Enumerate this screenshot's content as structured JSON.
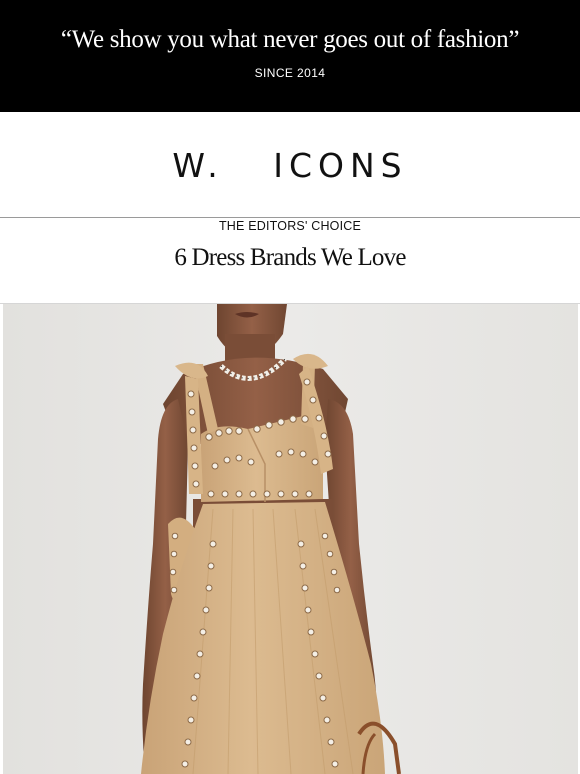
{
  "banner": {
    "quote": "“We show you what never goes out of fashion”",
    "since": "SINCE 2014"
  },
  "brand": {
    "logo": "W.   ICONS"
  },
  "article": {
    "kicker": "THE EDITORS' CHOICE",
    "headline": "6 Dress Brands We Love"
  },
  "hero_image": {
    "subject": "model-in-tan-eyelet-cutout-dress-icon",
    "colors": {
      "background": "#e7e6e3",
      "dress": "#d7b487",
      "skin": "#8a5a3f",
      "eyelet": "#f4efe6"
    }
  }
}
